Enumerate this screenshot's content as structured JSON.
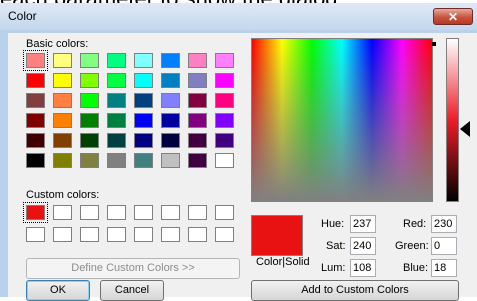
{
  "background_text": "each parameter to show the dialog",
  "window": {
    "title": "Color",
    "close_glyph": "✕"
  },
  "basic_colors": {
    "label": "Basic colors:",
    "swatches": [
      "#ff8080",
      "#ffff80",
      "#80ff80",
      "#00ff80",
      "#80ffff",
      "#0080ff",
      "#ff80c0",
      "#ff80ff",
      "#ff0000",
      "#ffff00",
      "#80ff00",
      "#00ff40",
      "#00ffff",
      "#0080c0",
      "#8080c0",
      "#ff00ff",
      "#804040",
      "#ff8040",
      "#00ff00",
      "#008080",
      "#004080",
      "#8080ff",
      "#800040",
      "#ff0080",
      "#800000",
      "#ff8000",
      "#008000",
      "#008040",
      "#0000ff",
      "#0000a0",
      "#800080",
      "#8000ff",
      "#400000",
      "#804000",
      "#004000",
      "#004040",
      "#000080",
      "#000040",
      "#400040",
      "#400080",
      "#000000",
      "#808000",
      "#808040",
      "#808080",
      "#408080",
      "#c0c0c0",
      "#400040",
      "#ffffff"
    ]
  },
  "custom_colors": {
    "label": "Custom colors:",
    "swatches": [
      "#e81212",
      "#ffffff",
      "#ffffff",
      "#ffffff",
      "#ffffff",
      "#ffffff",
      "#ffffff",
      "#ffffff",
      "#ffffff",
      "#ffffff",
      "#ffffff",
      "#ffffff",
      "#ffffff",
      "#ffffff",
      "#ffffff",
      "#ffffff"
    ]
  },
  "buttons": {
    "define_custom": "Define Custom Colors >>",
    "ok": "OK",
    "cancel": "Cancel",
    "add_custom": "Add to Custom Colors"
  },
  "preview": {
    "label": "Color|Solid",
    "color": "#e81212"
  },
  "fields": {
    "hue_label": "Hue:",
    "hue": "237",
    "sat_label": "Sat:",
    "sat": "240",
    "lum_label": "Lum:",
    "lum": "108",
    "red_label": "Red:",
    "red": "230",
    "green_label": "Green:",
    "green": "0",
    "blue_label": "Blue:",
    "blue": "18"
  }
}
